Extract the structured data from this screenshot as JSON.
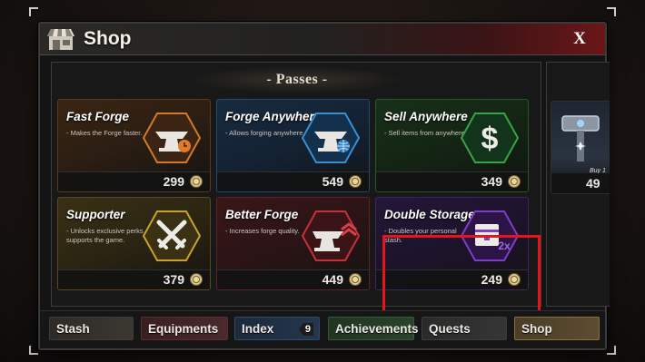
{
  "window": {
    "title": "Shop",
    "close_label": "X"
  },
  "section": {
    "title": "- Passes -"
  },
  "passes": [
    {
      "name": "Fast Forge",
      "description": "- Makes the Forge faster.",
      "price": "299",
      "icon": "anvil-clock-icon",
      "theme": "#b3651f"
    },
    {
      "name": "Forge Anywhere",
      "description": "- Allows forging anywhere.",
      "price": "549",
      "icon": "anvil-globe-icon",
      "theme": "#2b7fc0"
    },
    {
      "name": "Sell Anywhere",
      "description": "- Sell items from anywhere.",
      "price": "349",
      "icon": "dollar-icon",
      "theme": "#2f9b3a"
    },
    {
      "name": "Supporter",
      "description": "- Unlocks exclusive perks & supports the game.",
      "price": "379",
      "icon": "crossed-swords-icon",
      "theme": "#b59020"
    },
    {
      "name": "Better Forge",
      "description": "- Increases forge quality.",
      "price": "449",
      "icon": "anvil-chevrons-icon",
      "theme": "#b02a30"
    },
    {
      "name": "Double Storage",
      "description": "- Doubles your personal stash.",
      "price": "249",
      "icon": "storage-2x-icon",
      "theme": "#6f2fb0"
    }
  ],
  "side_item": {
    "label": "Buy 1",
    "price": "49",
    "icon": "hammer-icon"
  },
  "tabs": [
    {
      "label": "Stash",
      "badge": ""
    },
    {
      "label": "Equipments",
      "badge": ""
    },
    {
      "label": "Index",
      "badge": "9"
    },
    {
      "label": "Achievements",
      "badge": ""
    },
    {
      "label": "Quests",
      "badge": ""
    },
    {
      "label": "Shop",
      "badge": ""
    }
  ],
  "colors": {
    "highlight": "#e8141c",
    "title_accent": "#6a1618"
  }
}
